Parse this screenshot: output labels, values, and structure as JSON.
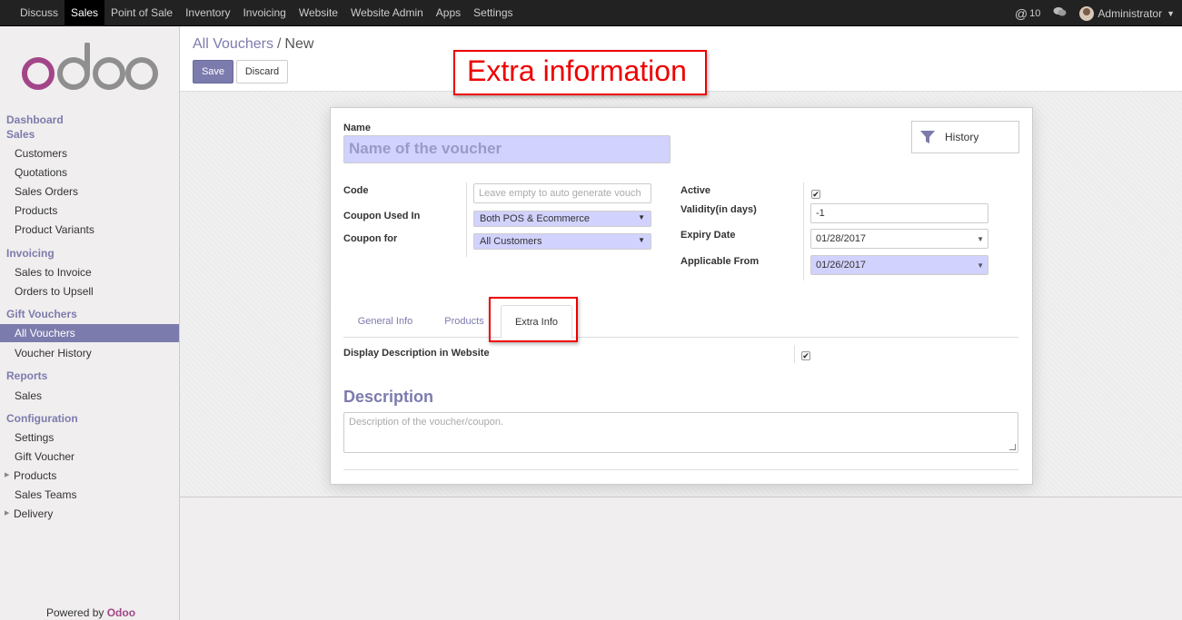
{
  "topbar": {
    "menu": [
      {
        "label": "Discuss",
        "active": false
      },
      {
        "label": "Sales",
        "active": true
      },
      {
        "label": "Point of Sale",
        "active": false
      },
      {
        "label": "Inventory",
        "active": false
      },
      {
        "label": "Invoicing",
        "active": false
      },
      {
        "label": "Website",
        "active": false
      },
      {
        "label": "Website Admin",
        "active": false
      },
      {
        "label": "Apps",
        "active": false
      },
      {
        "label": "Settings",
        "active": false
      }
    ],
    "mentions_icon": "at-icon",
    "mentions_count": "10",
    "chat_icon": "chat-bubbles-icon",
    "user_name": "Administrator"
  },
  "sidebar": {
    "logo_text": "odoo",
    "sections": [
      {
        "title": "Dashboard"
      },
      {
        "title": "Sales",
        "items": [
          "Customers",
          "Quotations",
          "Sales Orders",
          "Products",
          "Product Variants"
        ]
      },
      {
        "title": "Invoicing",
        "items": [
          "Sales to Invoice",
          "Orders to Upsell"
        ]
      },
      {
        "title": "Gift Vouchers",
        "items": [
          "All Vouchers",
          "Voucher History"
        ]
      },
      {
        "title": "Reports",
        "items": [
          "Sales"
        ]
      },
      {
        "title": "Configuration",
        "items": [
          "Settings",
          "Gift Voucher",
          "Products",
          "Sales Teams",
          "Delivery"
        ]
      }
    ],
    "active_item": "All Vouchers",
    "powered_by": "Powered by",
    "powered_brand": "Odoo"
  },
  "control_panel": {
    "breadcrumb_link": "All Vouchers",
    "breadcrumb_sep": "/",
    "breadcrumb_current": "New",
    "save_label": "Save",
    "discard_label": "Discard"
  },
  "form": {
    "name_label": "Name",
    "name_placeholder": "Name of the voucher",
    "history_label": "History",
    "code_label": "Code",
    "code_placeholder": "Leave empty to auto generate vouch",
    "coupon_used_in_label": "Coupon Used In",
    "coupon_used_in_value": "Both POS & Ecommerce",
    "coupon_for_label": "Coupon for",
    "coupon_for_value": "All Customers",
    "active_label": "Active",
    "active_checked": true,
    "validity_label": "Validity(in days)",
    "validity_value": "-1",
    "expiry_label": "Expiry Date",
    "expiry_value": "01/28/2017",
    "applicable_label": "Applicable From",
    "applicable_value": "01/26/2017",
    "tabs": [
      {
        "label": "General Info",
        "active": false
      },
      {
        "label": "Products",
        "active": false
      },
      {
        "label": "Extra Info",
        "active": true
      }
    ],
    "display_desc_label": "Display Description in Website",
    "display_desc_checked": true,
    "description_title": "Description",
    "description_placeholder": "Description of the voucher/coupon."
  },
  "annotation": {
    "text": "Extra information",
    "color": "#ee0000"
  },
  "colors": {
    "accent": "#7c7bad",
    "required_bg": "#d2d2ff",
    "brand": "#a24689"
  }
}
